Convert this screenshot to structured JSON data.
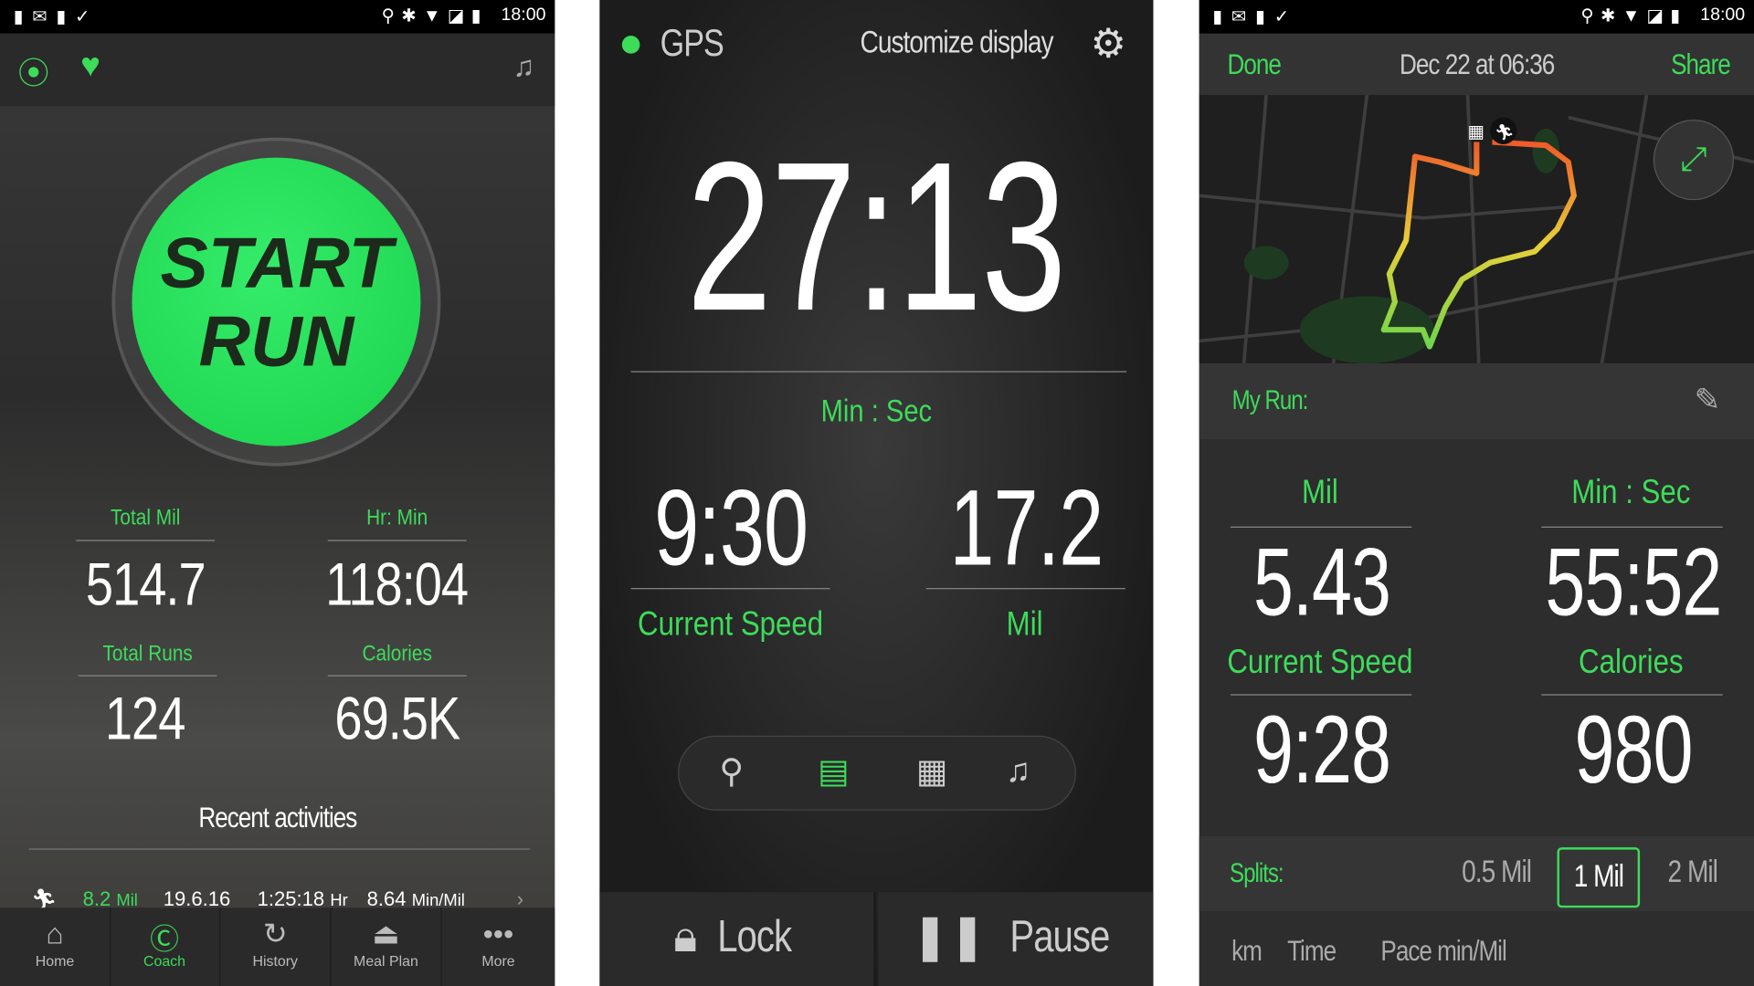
{
  "status_bar": {
    "time": "18:00"
  },
  "home": {
    "start_button": "START RUN",
    "stats": [
      {
        "label": "Total Mil",
        "value": "514.7"
      },
      {
        "label": "Hr: Min",
        "value": "118:04"
      },
      {
        "label": "Total Runs",
        "value": "124"
      },
      {
        "label": "Calories",
        "value": "69.5K"
      }
    ],
    "recent_title": "Recent activities",
    "recent": [
      {
        "distance": "8.2",
        "distance_unit": "Mil",
        "date": "19.6.16",
        "duration": "1:25:18",
        "duration_unit": "Hr",
        "pace": "8.64",
        "pace_unit": "Min/Mil"
      }
    ],
    "nav": [
      {
        "label": "Home",
        "icon": "home-icon"
      },
      {
        "label": "Coach",
        "icon": "coach-cap-icon",
        "active": true
      },
      {
        "label": "History",
        "icon": "history-icon"
      },
      {
        "label": "Meal Plan",
        "icon": "meal-plan-icon"
      },
      {
        "label": "More",
        "icon": "more-icon"
      }
    ],
    "accent": "#2ee05a"
  },
  "workout": {
    "gps_label": "GPS",
    "customize": "Customize display",
    "timer": "27:13",
    "timer_label": "Min : Sec",
    "speed": "9:30",
    "speed_label": "Current Speed",
    "distance": "17.2",
    "distance_label": "Mil",
    "toolbar": [
      "map-pin-icon",
      "notes-icon",
      "calendar-icon",
      "music-icon"
    ],
    "lock": "Lock",
    "pause": "Pause"
  },
  "summary": {
    "done": "Done",
    "date": "Dec 22 at 06:36",
    "share": "Share",
    "name_label": "My Run:",
    "stats": [
      {
        "label": "Mil",
        "value": "5.43"
      },
      {
        "label": "Min : Sec",
        "value": "55:52"
      },
      {
        "label": "Current Speed",
        "value": "9:28"
      },
      {
        "label": "Calories",
        "value": "980"
      }
    ],
    "splits_label": "Splits:",
    "splits": [
      "0.5 Mil",
      "1 Mil",
      "2 Mil"
    ],
    "splits_selected": "1 Mil",
    "table_headers": [
      "km",
      "Time",
      "Pace min/Mil"
    ]
  }
}
